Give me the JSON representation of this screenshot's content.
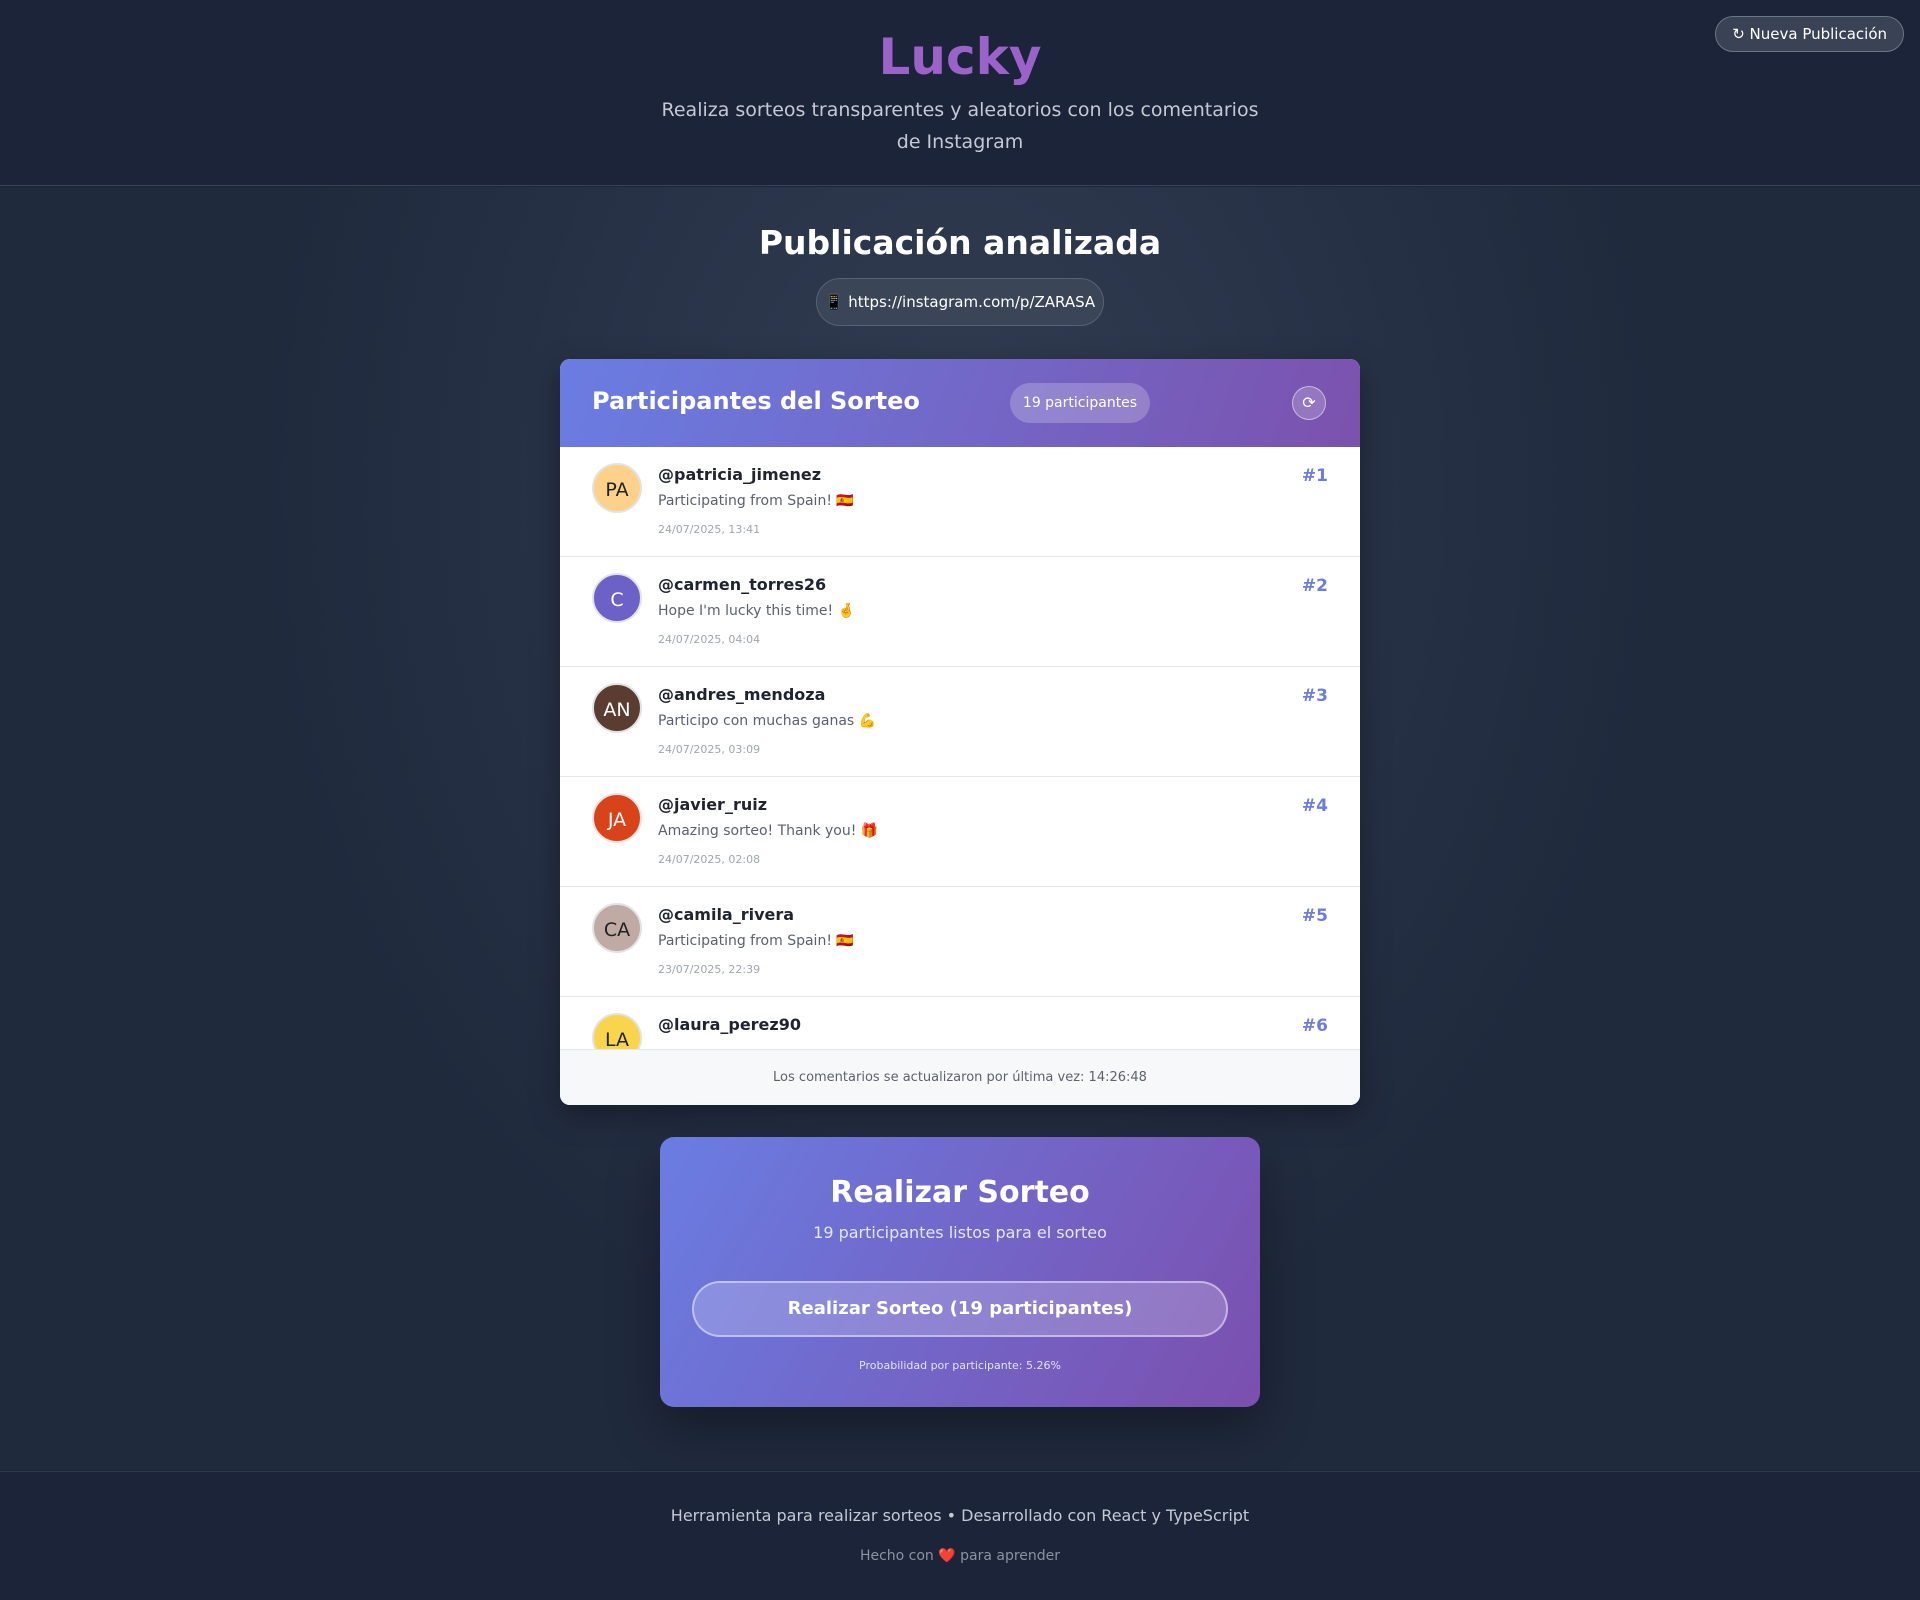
{
  "header": {
    "logo": "Lucky",
    "tagline": "Realiza sorteos transparentes y aleatorios con los comentarios de Instagram",
    "new_pub_button": "↻ Nueva Publicación"
  },
  "publication": {
    "title": "Publicación analizada",
    "url": "📱 https://instagram.com/p/ZARASA"
  },
  "participants_card": {
    "title": "Participantes del Sorteo",
    "count_badge": "19 participantes",
    "refresh_icon": "refresh-icon",
    "items": [
      {
        "initials": "PA",
        "avatar_color": "#fdd189",
        "username": "@patricia_jimenez",
        "comment": "Participating from Spain! 🇪🇸",
        "date": "24/07/2025, 13:41",
        "rank": "#1"
      },
      {
        "initials": "C",
        "avatar_color": "#6b61c7",
        "username": "@carmen_torres26",
        "comment": "Hope I'm lucky this time! 🤞",
        "date": "24/07/2025, 04:04",
        "rank": "#2"
      },
      {
        "initials": "AN",
        "avatar_color": "#5a3c31",
        "username": "@andres_mendoza",
        "comment": "Participo con muchas ganas 💪",
        "date": "24/07/2025, 03:09",
        "rank": "#3"
      },
      {
        "initials": "JA",
        "avatar_color": "#d8431a",
        "username": "@javier_ruiz",
        "comment": "Amazing sorteo! Thank you! 🎁",
        "date": "24/07/2025, 02:08",
        "rank": "#4"
      },
      {
        "initials": "CA",
        "avatar_color": "#c0aba4",
        "username": "@camila_rivera",
        "comment": "Participating from Spain! 🇪🇸",
        "date": "23/07/2025, 22:39",
        "rank": "#5"
      },
      {
        "initials": "LA",
        "avatar_color": "#f8d54c",
        "username": "@laura_perez90",
        "comment": "",
        "date": "",
        "rank": "#6"
      }
    ],
    "footer": "Los comentarios se actualizaron por última vez: 14:26:48"
  },
  "draw": {
    "title": "Realizar Sorteo",
    "subtitle": "19 participantes listos para el sorteo",
    "button": "Realizar Sorteo (19 participantes)",
    "probability": "Probabilidad por participante: 5.26%"
  },
  "footer": {
    "line1": "Herramienta para realizar sorteos • Desarrollado con React y TypeScript",
    "line2": "Hecho con ❤️ para aprender"
  }
}
